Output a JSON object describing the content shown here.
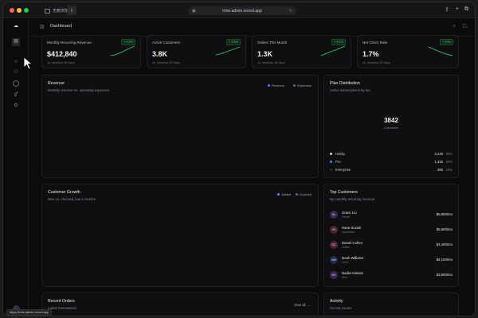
{
  "browser": {
    "tab_label": "无痕浏览",
    "url": "trms-admin.vercel.app",
    "status_url": "https://trms-admin.vercel.app"
  },
  "header": {
    "title": "Dashboard"
  },
  "kpis": [
    {
      "label": "Monthly Recurring Revenue",
      "value": "$412,840",
      "sub": "vs. previous 30 days",
      "delta": "+ 6.2%"
    },
    {
      "label": "Active Customers",
      "value": "3.8K",
      "sub": "vs. previous 30 days",
      "delta": "+ 3.4%"
    },
    {
      "label": "Orders This Month",
      "value": "1.3K",
      "sub": "vs. previous 30 days",
      "delta": "+ 5.1%"
    },
    {
      "label": "Net Churn Rate",
      "value": "1.7%",
      "sub": "vs. previous 30 days",
      "delta": "+ 20%"
    }
  ],
  "revenue": {
    "title": "Revenue",
    "subtitle": "Monthly revenue vs. operating expenses",
    "legend": [
      "Revenue",
      "Expenses"
    ]
  },
  "plan_distribution": {
    "title": "Plan Distribution",
    "subtitle": "Active subscriptions by tier",
    "total": "3842",
    "total_label": "Customers",
    "rows": [
      {
        "name": "Hobby",
        "count": "2,140",
        "pct": "56%"
      },
      {
        "name": "Pro",
        "count": "1,320",
        "pct": "34%"
      },
      {
        "name": "Enterprise",
        "count": "382",
        "pct": "10%"
      }
    ]
  },
  "customer_growth": {
    "title": "Customer Growth",
    "subtitle": "New vs. churned, last 6 months",
    "legend": [
      "Added",
      "Churned"
    ]
  },
  "top_customers": {
    "title": "Top Customers",
    "subtitle": "By monthly recurring revenue",
    "rows": [
      {
        "initials": "GL",
        "name": "Grace Liu",
        "company": "Vercel",
        "amount": "$6,800/mo"
      },
      {
        "initials": "HS",
        "name": "Hana Suzuki",
        "company": "Supabase",
        "amount": "$5,600/mo"
      },
      {
        "initials": "DC",
        "name": "Daniel Cohen",
        "company": "Notion",
        "amount": "$4,400/mo"
      },
      {
        "initials": "NW",
        "name": "Noah Williams",
        "company": "Clerk",
        "amount": "$4,100/mo"
      },
      {
        "initials": "NH",
        "name": "Nadia Hassan",
        "company": "Mux",
        "amount": "$3,900/mo"
      }
    ]
  },
  "recent_orders": {
    "title": "Recent Orders",
    "subtitle": "Latest transactions",
    "view_all": "View all →"
  },
  "activity": {
    "title": "Activity",
    "subtitle": "Recent events"
  }
}
